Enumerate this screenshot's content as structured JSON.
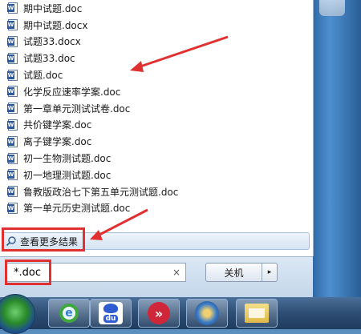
{
  "results": [
    "期中试题.doc",
    "期中试题.docx",
    "试题33.docx",
    "试题33.doc",
    "试题.doc",
    "化学反应速率学案.doc",
    "第一章单元测试试卷.doc",
    "共价键学案.doc",
    "离子键学案.doc",
    "初一生物测试题.doc",
    "初一地理测试题.doc",
    "鲁教版政治七下第五单元测试题.doc",
    "第一单元历史测试题.doc"
  ],
  "see_more_label": "查看更多结果",
  "search": {
    "value": "*.doc",
    "clear": "×"
  },
  "shutdown": {
    "label": "关机",
    "arrow": "▸"
  },
  "taskbar": {
    "baidu_text": "du"
  },
  "colors": {
    "annotation": "#e03030",
    "menu_bg": "#ffffff",
    "taskbar": "#2d4d73"
  }
}
